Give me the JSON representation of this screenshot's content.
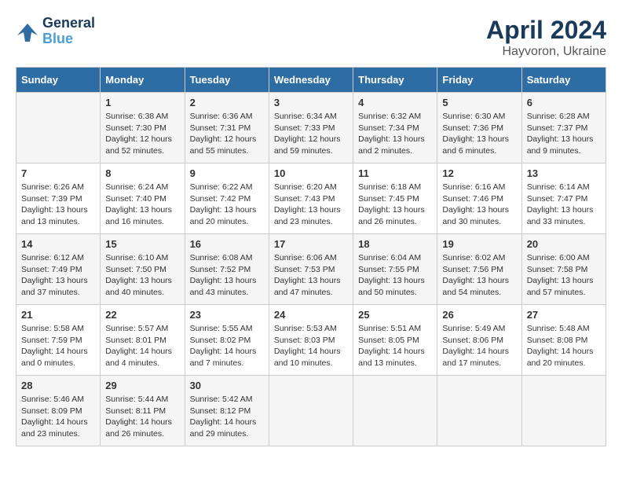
{
  "logo": {
    "line1": "General",
    "line2": "Blue"
  },
  "title": "April 2024",
  "location": "Hayvoron, Ukraine",
  "days_header": [
    "Sunday",
    "Monday",
    "Tuesday",
    "Wednesday",
    "Thursday",
    "Friday",
    "Saturday"
  ],
  "weeks": [
    [
      {
        "day": "",
        "info": ""
      },
      {
        "day": "1",
        "info": "Sunrise: 6:38 AM\nSunset: 7:30 PM\nDaylight: 12 hours\nand 52 minutes."
      },
      {
        "day": "2",
        "info": "Sunrise: 6:36 AM\nSunset: 7:31 PM\nDaylight: 12 hours\nand 55 minutes."
      },
      {
        "day": "3",
        "info": "Sunrise: 6:34 AM\nSunset: 7:33 PM\nDaylight: 12 hours\nand 59 minutes."
      },
      {
        "day": "4",
        "info": "Sunrise: 6:32 AM\nSunset: 7:34 PM\nDaylight: 13 hours\nand 2 minutes."
      },
      {
        "day": "5",
        "info": "Sunrise: 6:30 AM\nSunset: 7:36 PM\nDaylight: 13 hours\nand 6 minutes."
      },
      {
        "day": "6",
        "info": "Sunrise: 6:28 AM\nSunset: 7:37 PM\nDaylight: 13 hours\nand 9 minutes."
      }
    ],
    [
      {
        "day": "7",
        "info": "Sunrise: 6:26 AM\nSunset: 7:39 PM\nDaylight: 13 hours\nand 13 minutes."
      },
      {
        "day": "8",
        "info": "Sunrise: 6:24 AM\nSunset: 7:40 PM\nDaylight: 13 hours\nand 16 minutes."
      },
      {
        "day": "9",
        "info": "Sunrise: 6:22 AM\nSunset: 7:42 PM\nDaylight: 13 hours\nand 20 minutes."
      },
      {
        "day": "10",
        "info": "Sunrise: 6:20 AM\nSunset: 7:43 PM\nDaylight: 13 hours\nand 23 minutes."
      },
      {
        "day": "11",
        "info": "Sunrise: 6:18 AM\nSunset: 7:45 PM\nDaylight: 13 hours\nand 26 minutes."
      },
      {
        "day": "12",
        "info": "Sunrise: 6:16 AM\nSunset: 7:46 PM\nDaylight: 13 hours\nand 30 minutes."
      },
      {
        "day": "13",
        "info": "Sunrise: 6:14 AM\nSunset: 7:47 PM\nDaylight: 13 hours\nand 33 minutes."
      }
    ],
    [
      {
        "day": "14",
        "info": "Sunrise: 6:12 AM\nSunset: 7:49 PM\nDaylight: 13 hours\nand 37 minutes."
      },
      {
        "day": "15",
        "info": "Sunrise: 6:10 AM\nSunset: 7:50 PM\nDaylight: 13 hours\nand 40 minutes."
      },
      {
        "day": "16",
        "info": "Sunrise: 6:08 AM\nSunset: 7:52 PM\nDaylight: 13 hours\nand 43 minutes."
      },
      {
        "day": "17",
        "info": "Sunrise: 6:06 AM\nSunset: 7:53 PM\nDaylight: 13 hours\nand 47 minutes."
      },
      {
        "day": "18",
        "info": "Sunrise: 6:04 AM\nSunset: 7:55 PM\nDaylight: 13 hours\nand 50 minutes."
      },
      {
        "day": "19",
        "info": "Sunrise: 6:02 AM\nSunset: 7:56 PM\nDaylight: 13 hours\nand 54 minutes."
      },
      {
        "day": "20",
        "info": "Sunrise: 6:00 AM\nSunset: 7:58 PM\nDaylight: 13 hours\nand 57 minutes."
      }
    ],
    [
      {
        "day": "21",
        "info": "Sunrise: 5:58 AM\nSunset: 7:59 PM\nDaylight: 14 hours\nand 0 minutes."
      },
      {
        "day": "22",
        "info": "Sunrise: 5:57 AM\nSunset: 8:01 PM\nDaylight: 14 hours\nand 4 minutes."
      },
      {
        "day": "23",
        "info": "Sunrise: 5:55 AM\nSunset: 8:02 PM\nDaylight: 14 hours\nand 7 minutes."
      },
      {
        "day": "24",
        "info": "Sunrise: 5:53 AM\nSunset: 8:03 PM\nDaylight: 14 hours\nand 10 minutes."
      },
      {
        "day": "25",
        "info": "Sunrise: 5:51 AM\nSunset: 8:05 PM\nDaylight: 14 hours\nand 13 minutes."
      },
      {
        "day": "26",
        "info": "Sunrise: 5:49 AM\nSunset: 8:06 PM\nDaylight: 14 hours\nand 17 minutes."
      },
      {
        "day": "27",
        "info": "Sunrise: 5:48 AM\nSunset: 8:08 PM\nDaylight: 14 hours\nand 20 minutes."
      }
    ],
    [
      {
        "day": "28",
        "info": "Sunrise: 5:46 AM\nSunset: 8:09 PM\nDaylight: 14 hours\nand 23 minutes."
      },
      {
        "day": "29",
        "info": "Sunrise: 5:44 AM\nSunset: 8:11 PM\nDaylight: 14 hours\nand 26 minutes."
      },
      {
        "day": "30",
        "info": "Sunrise: 5:42 AM\nSunset: 8:12 PM\nDaylight: 14 hours\nand 29 minutes."
      },
      {
        "day": "",
        "info": ""
      },
      {
        "day": "",
        "info": ""
      },
      {
        "day": "",
        "info": ""
      },
      {
        "day": "",
        "info": ""
      }
    ]
  ]
}
